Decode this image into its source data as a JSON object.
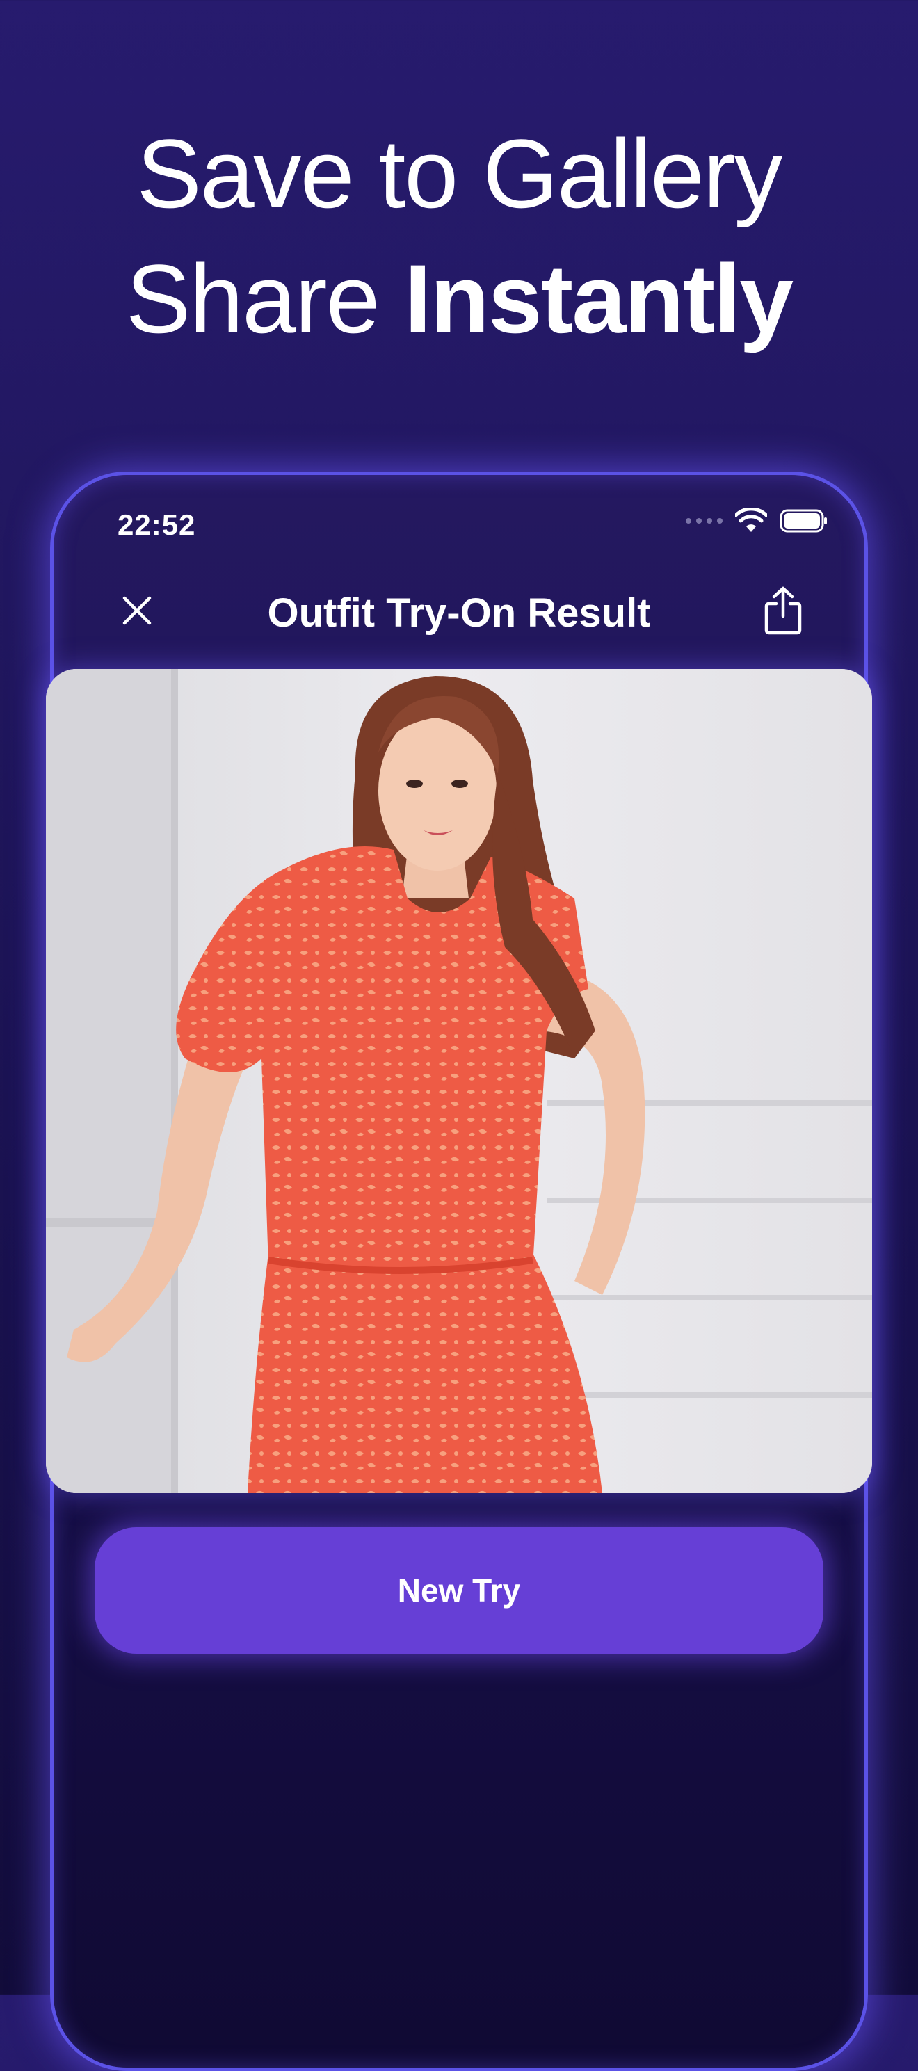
{
  "headline": {
    "line1": "Save to Gallery",
    "line2_regular": "Share",
    "line2_bold": "Instantly"
  },
  "status_bar": {
    "time": "22:52",
    "icons": [
      "signal-dots-icon",
      "wifi-icon",
      "battery-icon"
    ]
  },
  "nav": {
    "title": "Outfit Try-On Result",
    "close_icon": "close-icon",
    "share_icon": "share-icon"
  },
  "result_image": {
    "subject": "woman in red floral short-sleeve dress"
  },
  "actions": {
    "new_try_label": "New Try"
  },
  "colors": {
    "background": "#21175f",
    "device_border": "#5b52e6",
    "button": "#663fd6",
    "dress": "#ec5a46"
  }
}
